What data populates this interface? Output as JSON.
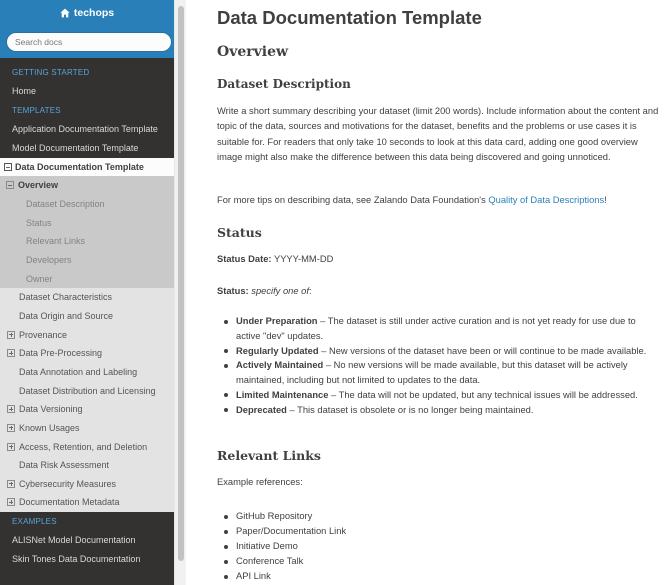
{
  "sidebar": {
    "brand": "techops",
    "search_placeholder": "Search docs",
    "caption_getting_started": "GETTING STARTED",
    "home": "Home",
    "caption_templates": "TEMPLATES",
    "app_doc_template": "Application Documentation Template",
    "model_doc_template": "Model Documentation Template",
    "current": {
      "label": "Data Documentation Template",
      "open_section": "Overview",
      "subitems": [
        "Dataset Description",
        "Status",
        "Relevant Links",
        "Developers",
        "Owner"
      ],
      "sections": [
        {
          "label": "Dataset Characteristics",
          "expandable": false
        },
        {
          "label": "Data Origin and Source",
          "expandable": false
        },
        {
          "label": "Provenance",
          "expandable": true
        },
        {
          "label": "Data Pre-Processing",
          "expandable": true
        },
        {
          "label": "Data Annotation and Labeling",
          "expandable": false
        },
        {
          "label": "Dataset Distribution and Licensing",
          "expandable": false
        },
        {
          "label": "Data Versioning",
          "expandable": true
        },
        {
          "label": "Known Usages",
          "expandable": true
        },
        {
          "label": "Access, Retention, and Deletion",
          "expandable": true
        },
        {
          "label": "Data Risk Assessment",
          "expandable": false
        },
        {
          "label": "Cybersecurity Measures",
          "expandable": true
        },
        {
          "label": "Documentation Metadata",
          "expandable": true
        }
      ]
    },
    "caption_examples": "EXAMPLES",
    "examples": [
      "ALISNet Model Documentation",
      "Skin Tones Data Documentation"
    ]
  },
  "content": {
    "title": "Data Documentation Template",
    "overview_heading": "Overview",
    "dataset_description_heading": "Dataset Description",
    "dataset_description_text": "Write a short summary describing your dataset (limit 200 words). Include information about the content and topic of the data, sources and motivations for the dataset, benefits and the problems or use cases it is suitable for. For readers that only take 10 seconds to look at this data card, adding one good overview image might also make the difference between this data being discovered and going unnoticed.",
    "tips_prefix": "For more tips on describing data, see Zalando Data Foundation's ",
    "tips_link": "Quality of Data Descriptions",
    "tips_suffix": "!",
    "status_heading": "Status",
    "status_date_label": "Status Date:",
    "status_date_value": " YYYY-MM-DD",
    "status_label": "Status:",
    "status_hint": " specify one of",
    "status_hint_suffix": ":",
    "status_options": [
      {
        "term": "Under Preparation",
        "desc": " – The dataset is still under active curation and is not yet ready for use due to active \"dev\" updates."
      },
      {
        "term": "Regularly Updated",
        "desc": " – New versions of the dataset have been or will continue to be made available."
      },
      {
        "term": "Actively Maintained",
        "desc": " – No new versions will be made available, but this dataset will be actively maintained, including but not limited to updates to the data."
      },
      {
        "term": "Limited Maintenance",
        "desc": " – The data will not be updated, but any technical issues will be addressed."
      },
      {
        "term": "Deprecated",
        "desc": " – This dataset is obsolete or is no longer being maintained."
      }
    ],
    "relevant_links_heading": "Relevant Links",
    "example_references": "Example references:",
    "references": [
      "GitHub Repository",
      "Paper/Documentation Link",
      "Initiative Demo",
      "Conference Talk",
      "API Link"
    ]
  },
  "colors": {
    "sidebar_bg": "#343131",
    "sidebar_top": "#2980b9",
    "caption": "#55a5d9",
    "link": "#2980b9",
    "text": "#404040"
  }
}
